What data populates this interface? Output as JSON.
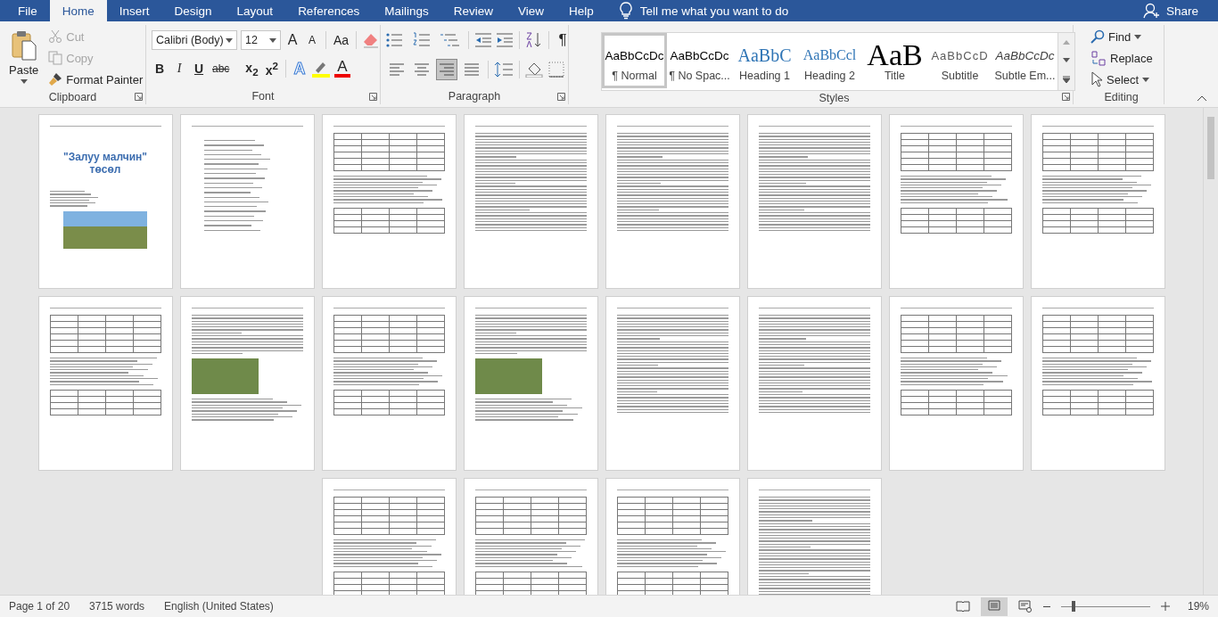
{
  "tabs": [
    {
      "label": "File",
      "selected": false
    },
    {
      "label": "Home",
      "selected": true
    },
    {
      "label": "Insert",
      "selected": false
    },
    {
      "label": "Design",
      "selected": false
    },
    {
      "label": "Layout",
      "selected": false
    },
    {
      "label": "References",
      "selected": false
    },
    {
      "label": "Mailings",
      "selected": false
    },
    {
      "label": "Review",
      "selected": false
    },
    {
      "label": "View",
      "selected": false
    },
    {
      "label": "Help",
      "selected": false
    }
  ],
  "tell_me": "Tell me what you want to do",
  "share": "Share",
  "clipboard": {
    "group": "Clipboard",
    "paste": "Paste",
    "cut": {
      "label": "Cut",
      "disabled": true
    },
    "copy": {
      "label": "Copy",
      "disabled": true
    },
    "format_painter": "Format Painter"
  },
  "font": {
    "group": "Font",
    "name": "Calibri (Body)",
    "size": "12",
    "grow": "A",
    "shrink": "A",
    "change_case": "Aa",
    "bold": "B",
    "italic": "I",
    "underline": "U",
    "strikethrough": "abc",
    "subscript": "x$_{2}$",
    "superscript": "x$^{2}$",
    "text_effects": "A",
    "font_color": "A"
  },
  "paragraph": {
    "group": "Paragraph",
    "show_marks": "¶",
    "alignments": [
      {
        "kind": "left",
        "selected": false
      },
      {
        "kind": "center",
        "selected": false
      },
      {
        "kind": "right",
        "selected": true
      },
      {
        "kind": "justify",
        "selected": false
      }
    ]
  },
  "styles": {
    "group": "Styles",
    "items": [
      {
        "kind": "normal",
        "sample": "AaBbCcDc",
        "name": "¶ Normal",
        "selected": true
      },
      {
        "kind": "normal",
        "sample": "AaBbCcDc",
        "name": "¶ No Spac...",
        "selected": false
      },
      {
        "kind": "heading1",
        "sample": "AaBbC",
        "name": "Heading 1",
        "selected": false
      },
      {
        "kind": "heading2",
        "sample": "AaBbCcl",
        "name": "Heading 2",
        "selected": false
      },
      {
        "kind": "title",
        "sample": "AaB",
        "name": "Title",
        "selected": false
      },
      {
        "kind": "subtitle",
        "sample": "AaBbCcD",
        "name": "Subtitle",
        "selected": false
      },
      {
        "kind": "emphasis",
        "sample": "AaBbCcDc",
        "name": "Subtle Em...",
        "selected": false
      }
    ]
  },
  "editing": {
    "group": "Editing",
    "find": "Find",
    "replace": "Replace",
    "select": "Select"
  },
  "pages": [
    {
      "kind": "cover",
      "title": "\"Залуу малчин\" төсөл"
    },
    {
      "kind": "list"
    },
    {
      "kind": "table"
    },
    {
      "kind": "text"
    },
    {
      "kind": "text"
    },
    {
      "kind": "text"
    },
    {
      "kind": "table"
    },
    {
      "kind": "table"
    },
    {
      "kind": "table"
    },
    {
      "kind": "photo"
    },
    {
      "kind": "table"
    },
    {
      "kind": "photo"
    },
    {
      "kind": "text"
    },
    {
      "kind": "text"
    },
    {
      "kind": "table"
    },
    {
      "kind": "table"
    },
    {
      "kind": "table"
    },
    {
      "kind": "table"
    },
    {
      "kind": "table"
    },
    {
      "kind": "text"
    }
  ],
  "status": {
    "page": "Page 1 of 20",
    "words": "3715 words",
    "language": "English (United States)",
    "zoom": "19%"
  },
  "zoom_slider": {
    "level": 0.12
  }
}
